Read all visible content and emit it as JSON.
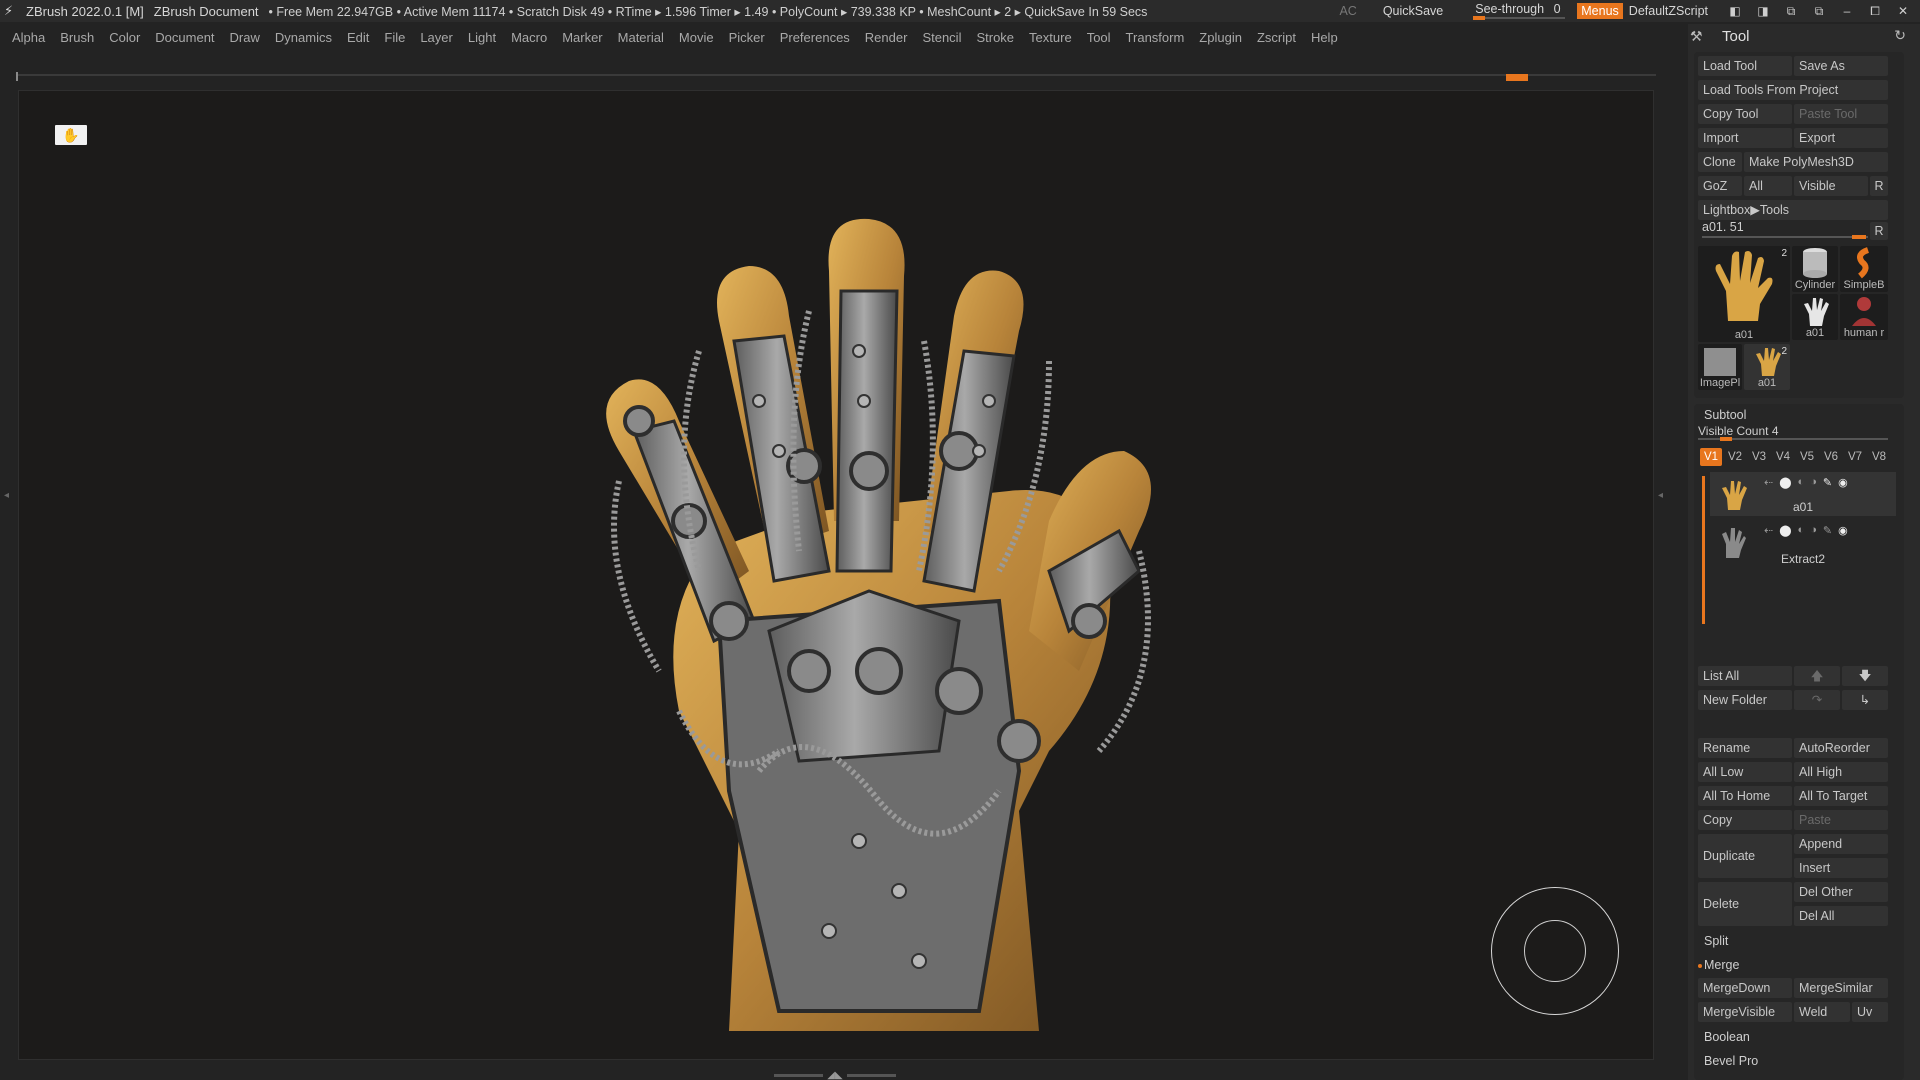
{
  "titlebar": {
    "app": "ZBrush 2022.0.1 [M]",
    "document": "ZBrush Document",
    "stats": "• Free Mem 22.947GB • Active Mem 11174 • Scratch Disk 49 • RTime ▸ 1.596 Timer ▸ 1.49 • PolyCount ▸ 739.338 KP • MeshCount ▸ 2 ▸ QuickSave In 59 Secs",
    "ac": "AC",
    "quicksave": "QuickSave",
    "see_through_label": "See-through",
    "see_through_value": "0",
    "see_through_level": 0,
    "menus": "Menus",
    "default_zscript": "DefaultZScript"
  },
  "menubar": {
    "items": [
      "Alpha",
      "Brush",
      "Color",
      "Document",
      "Draw",
      "Dynamics",
      "Edit",
      "File",
      "Layer",
      "Light",
      "Macro",
      "Marker",
      "Material",
      "Movie",
      "Picker",
      "Preferences",
      "Render",
      "Stencil",
      "Stroke",
      "Texture",
      "Tool",
      "Transform",
      "Zplugin",
      "Zscript",
      "Help"
    ]
  },
  "tool_panel": {
    "title": "Tool",
    "load_tool": "Load Tool",
    "save_as": "Save As",
    "load_from_project": "Load Tools From Project",
    "copy_tool": "Copy Tool",
    "paste_tool": "Paste Tool",
    "import": "Import",
    "export": "Export",
    "clone": "Clone",
    "make_polymesh": "Make PolyMesh3D",
    "goz": "GoZ",
    "all": "All",
    "visible": "Visible",
    "r": "R",
    "lightbox": "Lightbox▶Tools",
    "current_tool": "a01. 51",
    "thumbs": [
      {
        "caption": "a01",
        "count": "2"
      },
      {
        "caption": "Cylinder"
      },
      {
        "caption": "SimpleB"
      },
      {
        "caption": "a01"
      },
      {
        "caption": "human r"
      },
      {
        "caption": "ImagePl"
      },
      {
        "caption": "a01",
        "count": "2"
      }
    ]
  },
  "subtool": {
    "title": "Subtool",
    "visible_count": "Visible Count 4",
    "tabs": [
      "V1",
      "V2",
      "V3",
      "V4",
      "V5",
      "V6",
      "V7",
      "V8"
    ],
    "items": [
      {
        "name": "a01"
      },
      {
        "name": "Extract2"
      }
    ],
    "list_all": "List All",
    "new_folder": "New Folder",
    "rename": "Rename",
    "autoreorder": "AutoReorder",
    "all_low": "All Low",
    "all_high": "All High",
    "all_to_home": "All To Home",
    "all_to_target": "All To Target",
    "copy": "Copy",
    "paste": "Paste",
    "duplicate": "Duplicate",
    "append": "Append",
    "insert": "Insert",
    "delete": "Delete",
    "del_other": "Del Other",
    "del_all": "Del All",
    "split": "Split",
    "merge": "Merge",
    "mergedown": "MergeDown",
    "mergesimilar": "MergeSimilar",
    "mergevisible": "MergeVisible",
    "weld": "Weld",
    "uv": "Uv",
    "boolean": "Boolean",
    "bevel_pro": "Bevel Pro"
  },
  "colors": {
    "accent": "#e8761e",
    "panel_bg": "#2a2a2a",
    "canvas_bg": "#1c1b1a",
    "gold": "#c9953f",
    "metal": "#8d8d8d"
  },
  "icons": [
    "zbrush-logo-icon",
    "hand-icon",
    "pin-icon",
    "reset-icon",
    "arrow-up-icon",
    "arrow-down-icon",
    "folder-move-icon",
    "eye-icon",
    "brush-icon"
  ]
}
